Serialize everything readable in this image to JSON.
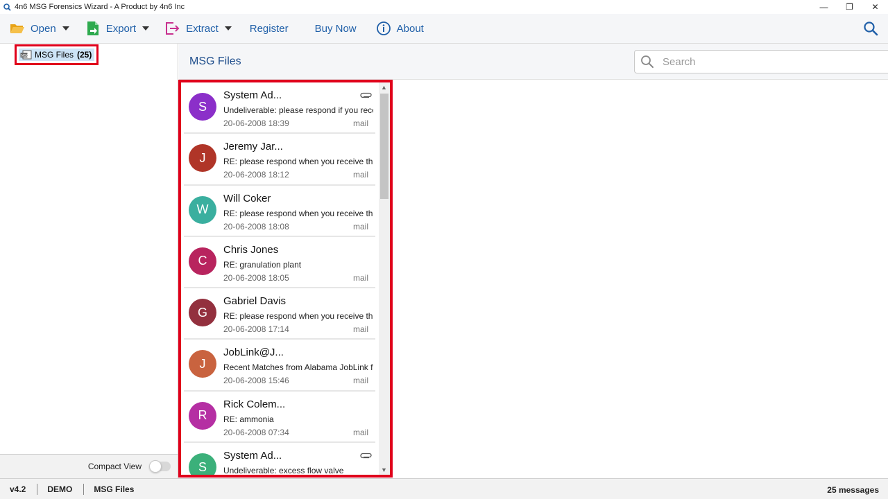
{
  "window": {
    "title": "4n6 MSG Forensics Wizard - A Product by 4n6 Inc",
    "minimize": "—",
    "maximize": "❐",
    "close": "✕"
  },
  "toolbar": {
    "open_label": "Open",
    "export_label": "Export",
    "extract_label": "Extract",
    "register_label": "Register",
    "buy_label": "Buy Now",
    "about_label": "About"
  },
  "tree": {
    "node_label": "MSG Files",
    "node_count": "(25)"
  },
  "compact_view": {
    "label": "Compact View",
    "enabled": false
  },
  "list_header": {
    "title": "MSG Files",
    "search_placeholder": "Search"
  },
  "messages": [
    {
      "sender": "System Ad...",
      "subject": "Undeliverable: please respond if you receive this",
      "date": "20-06-2008 18:39",
      "type": "mail",
      "initial": "S",
      "color": "#8b2fc9",
      "attachment": true
    },
    {
      "sender": "Jeremy Jar...",
      "subject": "RE: please respond when you receive this",
      "date": "20-06-2008 18:12",
      "type": "mail",
      "initial": "J",
      "color": "#b03528",
      "attachment": false
    },
    {
      "sender": "Will Coker",
      "subject": "RE: please respond when you receive this",
      "date": "20-06-2008 18:08",
      "type": "mail",
      "initial": "W",
      "color": "#3aaf9f",
      "attachment": false
    },
    {
      "sender": "Chris Jones",
      "subject": "RE: granulation plant",
      "date": "20-06-2008 18:05",
      "type": "mail",
      "initial": "C",
      "color": "#b8245e",
      "attachment": false
    },
    {
      "sender": "Gabriel Davis",
      "subject": "RE: please respond when you receive this",
      "date": "20-06-2008 17:14",
      "type": "mail",
      "initial": "G",
      "color": "#93303e",
      "attachment": false
    },
    {
      "sender": "JobLink@J...",
      "subject": "Recent Matches from Alabama JobLink for",
      "date": "20-06-2008 15:46",
      "type": "mail",
      "initial": "J",
      "color": "#c9633f",
      "attachment": false
    },
    {
      "sender": "Rick Colem...",
      "subject": "RE: ammonia",
      "date": "20-06-2008 07:34",
      "type": "mail",
      "initial": "R",
      "color": "#b52fa3",
      "attachment": false
    },
    {
      "sender": "System Ad...",
      "subject": "Undeliverable: excess flow valve",
      "date": "",
      "type": "",
      "initial": "S",
      "color": "#3bb07a",
      "attachment": true
    }
  ],
  "status": {
    "version": "v4.2",
    "mode": "DEMO",
    "folder": "MSG Files",
    "count": "25 messages"
  },
  "colors": {
    "accent": "#1f5fa8",
    "highlight_border": "#e0001b"
  }
}
